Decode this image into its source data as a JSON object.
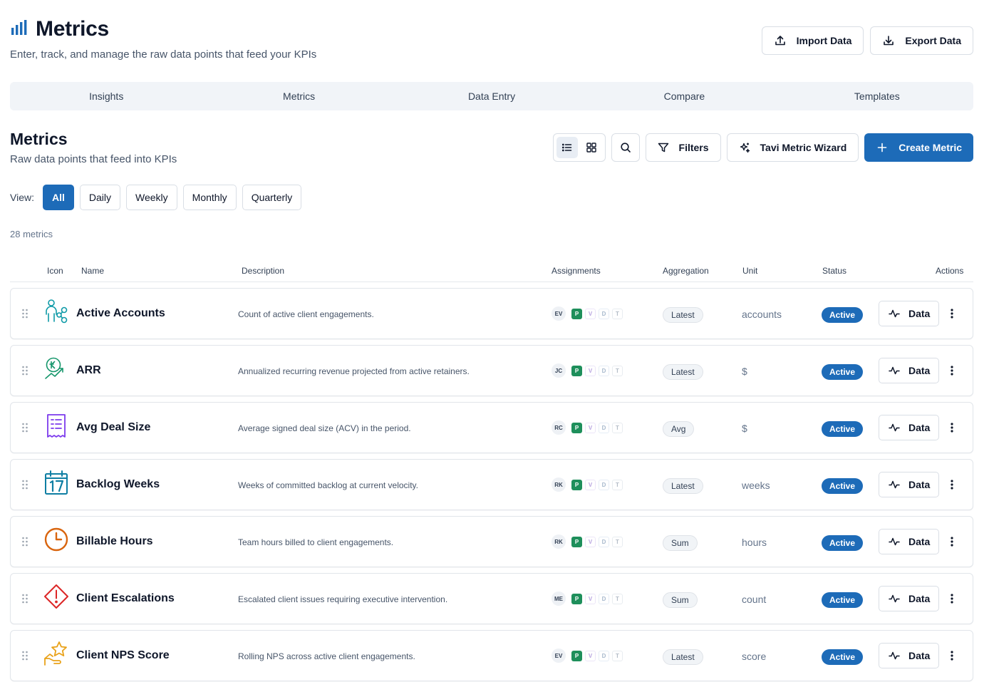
{
  "header": {
    "title": "Metrics",
    "subtitle": "Enter, track, and manage the raw data points that feed your KPIs",
    "import_label": "Import Data",
    "export_label": "Export Data"
  },
  "tabs": [
    {
      "label": "Insights"
    },
    {
      "label": "Metrics"
    },
    {
      "label": "Data Entry"
    },
    {
      "label": "Compare"
    },
    {
      "label": "Templates"
    }
  ],
  "section": {
    "title": "Metrics",
    "subtitle": "Raw data points that feed into KPIs",
    "filters_label": "Filters",
    "wizard_label": "Tavi Metric Wizard",
    "create_label": "Create Metric",
    "active_layout": "list"
  },
  "view_filter": {
    "label": "View:",
    "options": [
      "All",
      "Daily",
      "Weekly",
      "Monthly",
      "Quarterly"
    ],
    "selected": "All"
  },
  "count_text": "28 metrics",
  "columns": {
    "icon": "Icon",
    "name": "Name",
    "description": "Description",
    "assignments": "Assignments",
    "aggregation": "Aggregation",
    "unit": "Unit",
    "status": "Status",
    "actions": "Actions"
  },
  "assignment_flags": {
    "p": "P",
    "v": "V",
    "d": "D",
    "t": "T"
  },
  "data_button_label": "Data",
  "colors": {
    "primary": "#1d6bb8",
    "success": "#1e8f5b"
  },
  "rows": [
    {
      "icon": "users-network-icon",
      "icon_color": "#0e9aa7",
      "name": "Active Accounts",
      "description": "Count of active client engagements.",
      "owner": "EV",
      "aggregation": "Latest",
      "unit": "accounts",
      "status": "Active"
    },
    {
      "icon": "currency-trend-icon",
      "icon_color": "#15966b",
      "name": "ARR",
      "description": "Annualized recurring revenue projected from active retainers.",
      "owner": "JC",
      "aggregation": "Latest",
      "unit": "$",
      "status": "Active"
    },
    {
      "icon": "receipt-icon",
      "icon_color": "#7c3aed",
      "name": "Avg Deal Size",
      "description": "Average signed deal size (ACV) in the period.",
      "owner": "RC",
      "aggregation": "Avg",
      "unit": "$",
      "status": "Active"
    },
    {
      "icon": "calendar-17-icon",
      "icon_color": "#0e7ea3",
      "name": "Backlog Weeks",
      "description": "Weeks of committed backlog at current velocity.",
      "owner": "RK",
      "aggregation": "Latest",
      "unit": "weeks",
      "status": "Active"
    },
    {
      "icon": "clock-icon",
      "icon_color": "#d9650f",
      "name": "Billable Hours",
      "description": "Team hours billed to client engagements.",
      "owner": "RK",
      "aggregation": "Sum",
      "unit": "hours",
      "status": "Active"
    },
    {
      "icon": "alert-diamond-icon",
      "icon_color": "#dc2626",
      "name": "Client Escalations",
      "description": "Escalated client issues requiring executive intervention.",
      "owner": "ME",
      "aggregation": "Sum",
      "unit": "count",
      "status": "Active"
    },
    {
      "icon": "hand-star-icon",
      "icon_color": "#e9a21a",
      "name": "Client NPS Score",
      "description": "Rolling NPS across active client engagements.",
      "owner": "EV",
      "aggregation": "Latest",
      "unit": "score",
      "status": "Active"
    }
  ]
}
